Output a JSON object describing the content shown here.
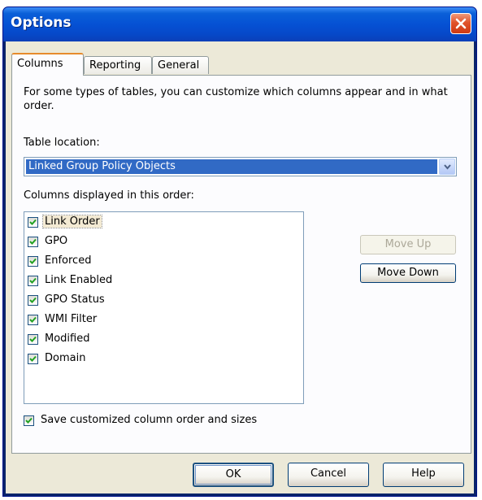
{
  "window": {
    "title": "Options",
    "close_icon": "close-icon"
  },
  "tabs": [
    {
      "label": "Columns",
      "active": true
    },
    {
      "label": "Reporting",
      "active": false
    },
    {
      "label": "General",
      "active": false
    }
  ],
  "columns_tab": {
    "description": "For some types of tables, you can customize which columns appear and in what order.",
    "table_location_label": "Table location:",
    "table_location_value": "Linked Group Policy Objects",
    "columns_label": "Columns displayed in this order:",
    "columns": [
      {
        "label": "Link Order",
        "checked": true
      },
      {
        "label": "GPO",
        "checked": true
      },
      {
        "label": "Enforced",
        "checked": true
      },
      {
        "label": "Link Enabled",
        "checked": true
      },
      {
        "label": "GPO Status",
        "checked": true
      },
      {
        "label": "WMI Filter",
        "checked": true
      },
      {
        "label": "Modified",
        "checked": true
      },
      {
        "label": "Domain",
        "checked": true
      }
    ],
    "move_up_label": "Move Up",
    "move_down_label": "Move Down",
    "save_option_label": "Save customized column order and sizes",
    "save_option_checked": true
  },
  "buttons": {
    "ok": "OK",
    "cancel": "Cancel",
    "help": "Help"
  },
  "colors": {
    "titlebar": "#0551d4",
    "selection": "#316ac5",
    "dialog_face": "#ece9d8",
    "active_tab_accent": "#e68b2c"
  }
}
